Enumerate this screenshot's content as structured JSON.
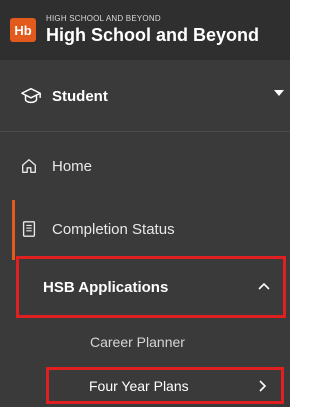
{
  "header": {
    "logo_text": "Hb",
    "small_title": "HIGH SCHOOL AND BEYOND",
    "large_title": "High School and Beyond"
  },
  "role": {
    "label": "Student",
    "icon": "graduation-cap-icon"
  },
  "nav": {
    "home": {
      "label": "Home",
      "icon": "home-icon"
    },
    "completion": {
      "label": "Completion Status",
      "icon": "document-icon"
    },
    "hsb_applications": {
      "label": "HSB Applications",
      "expanded": true
    },
    "career_planner": {
      "label": "Career Planner"
    },
    "four_year_plans": {
      "label": "Four Year Plans"
    }
  },
  "colors": {
    "sidebar_bg": "#3a3a3a",
    "header_bg": "#2f2f2f",
    "accent": "#e25a1c",
    "highlight_border": "#e02020"
  }
}
